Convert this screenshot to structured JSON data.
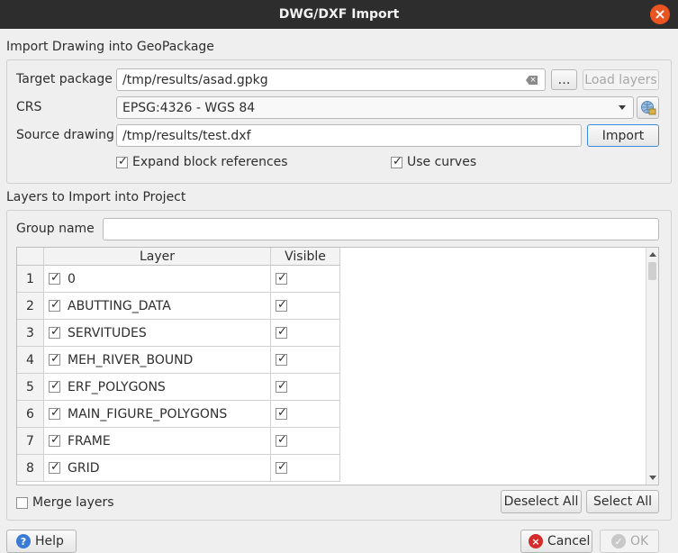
{
  "window": {
    "title": "DWG/DXF Import"
  },
  "import_group": {
    "title": "Import Drawing into GeoPackage",
    "target_package_label": "Target package",
    "target_package_value": "/tmp/results/asad.gpkg",
    "browse_label": "…",
    "load_layers_label": "Load layers",
    "crs_label": "CRS",
    "crs_value": "EPSG:4326 - WGS 84",
    "source_drawing_label": "Source drawing",
    "source_drawing_value": "/tmp/results/test.dxf",
    "import_label": "Import",
    "expand_block_label": "Expand block references",
    "expand_block_checked": true,
    "use_curves_label": "Use curves",
    "use_curves_checked": true
  },
  "layers_group": {
    "title": "Layers to Import into Project",
    "group_name_label": "Group name",
    "group_name_value": "",
    "columns": {
      "layer": "Layer",
      "visible": "Visible"
    },
    "rows": [
      {
        "num": "1",
        "name": "0",
        "checked": true,
        "visible": true
      },
      {
        "num": "2",
        "name": "ABUTTING_DATA",
        "checked": true,
        "visible": true
      },
      {
        "num": "3",
        "name": "SERVITUDES",
        "checked": true,
        "visible": true
      },
      {
        "num": "4",
        "name": "MEH_RIVER_BOUND",
        "checked": true,
        "visible": true
      },
      {
        "num": "5",
        "name": "ERF_POLYGONS",
        "checked": true,
        "visible": true
      },
      {
        "num": "6",
        "name": "MAIN_FIGURE_POLYGONS",
        "checked": true,
        "visible": true
      },
      {
        "num": "7",
        "name": "FRAME",
        "checked": true,
        "visible": true
      },
      {
        "num": "8",
        "name": "GRID",
        "checked": true,
        "visible": true
      }
    ],
    "merge_layers_label": "Merge layers",
    "merge_layers_checked": false,
    "deselect_all_label": "Deselect All",
    "select_all_label": "Select All"
  },
  "footer": {
    "help_label": "Help",
    "cancel_label": "Cancel",
    "ok_label": "OK"
  },
  "icons": {
    "close": "close-icon",
    "clear": "clear-text-icon",
    "dropdown": "chevron-down-icon",
    "crs_selector": "globe-icon",
    "help": "help-icon",
    "cancel": "cancel-icon",
    "ok": "ok-icon"
  },
  "colors": {
    "accent": "#e95420",
    "titlebar": "#2d2d2d",
    "help_icon": "#3a7bd5"
  }
}
